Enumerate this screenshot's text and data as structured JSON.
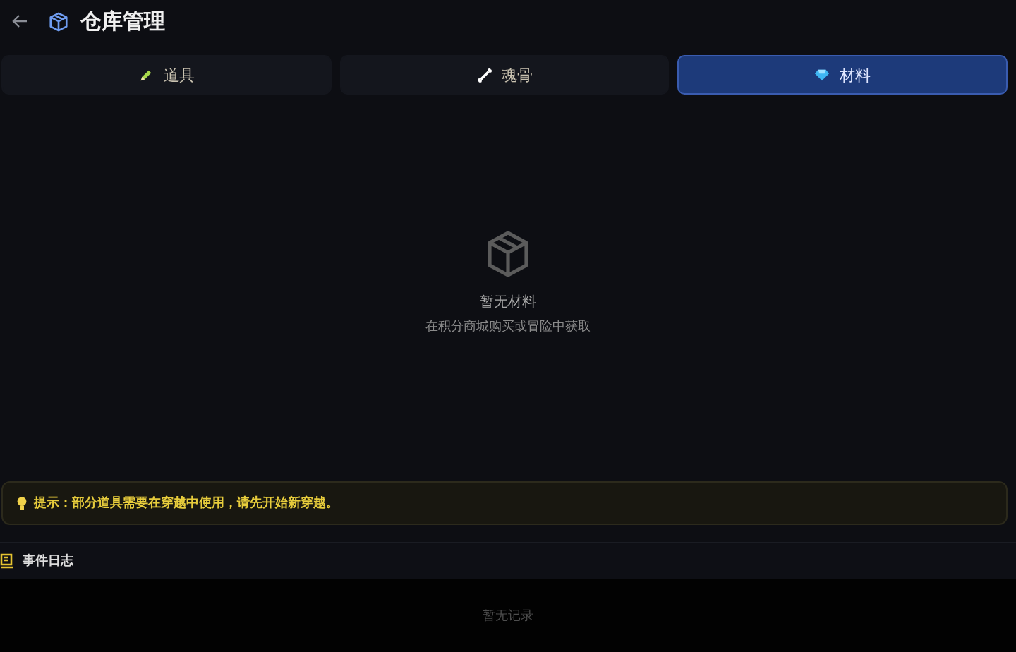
{
  "header": {
    "title": "仓库管理"
  },
  "tabs": [
    {
      "label": "道具",
      "kind": "pencil",
      "selected": false
    },
    {
      "label": "魂骨",
      "kind": "bone",
      "selected": false
    },
    {
      "label": "材料",
      "kind": "gem",
      "selected": true
    }
  ],
  "empty_state": {
    "title": "暂无材料",
    "subtitle": "在积分商城购买或冒险中获取"
  },
  "tip": {
    "text": "提示：部分道具需要在穿越中使用，请先开始新穿越。"
  },
  "event_log": {
    "title": "事件日志",
    "empty_text": "暂无记录"
  }
}
